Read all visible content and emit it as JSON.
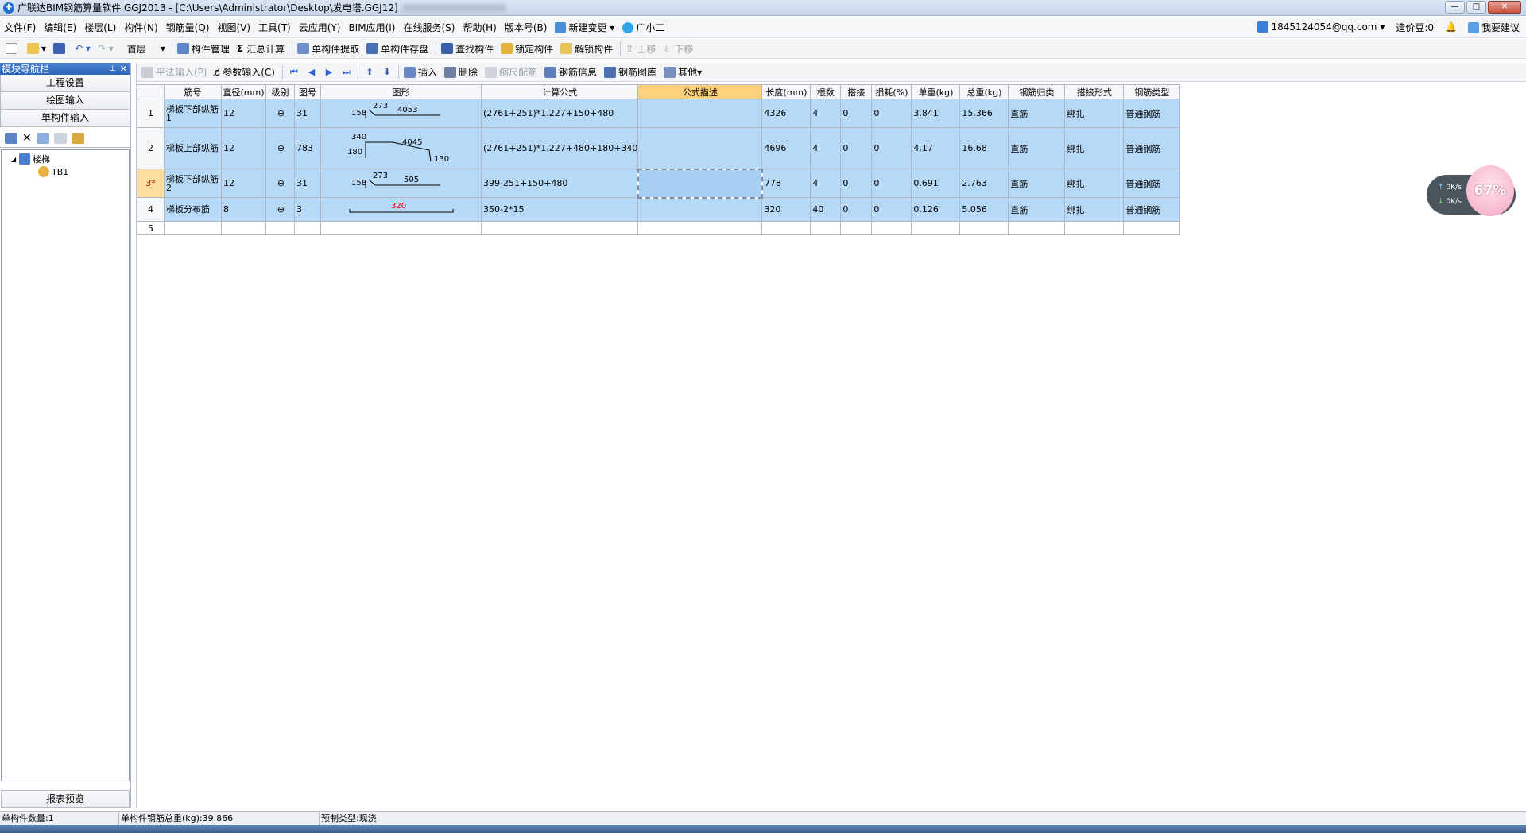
{
  "window": {
    "title": "广联达BIM钢筋算量软件 GGJ2013 - [C:\\Users\\Administrator\\Desktop\\发电塔.GGJ12]",
    "minimize": "—",
    "maximize": "□",
    "close": "✕"
  },
  "menu": {
    "items": [
      "文件(F)",
      "编辑(E)",
      "楼层(L)",
      "构件(N)",
      "钢筋量(Q)",
      "视图(V)",
      "工具(T)",
      "云应用(Y)",
      "BIM应用(I)",
      "在线服务(S)",
      "帮助(H)",
      "版本号(B)",
      "新建变更",
      "广小二"
    ],
    "account": "1845124054@qq.com",
    "price_beans": "造价豆:0",
    "suggest": "我要建议"
  },
  "toolbar1": {
    "floor": "首层",
    "component_manage": "构件管理",
    "sum_calc": "汇总计算",
    "single_extract": "单构件提取",
    "single_save": "单构件存盘",
    "find_component": "查找构件",
    "lock_component": "锁定构件",
    "unlock_component": "解锁构件",
    "move_up": "上移",
    "move_down": "下移"
  },
  "leftnav": {
    "header": "模块导航栏",
    "sections": [
      "工程设置",
      "绘图输入",
      "单构件输入"
    ],
    "tree_root": "楼梯",
    "tree_child": "TB1",
    "report": "报表预览"
  },
  "toolbar2": {
    "flat_input": "平法输入(P)",
    "param_input": "参数输入(C)",
    "insert": "插入",
    "delete": "删除",
    "scale_rebar": "缩尺配筋",
    "rebar_info": "钢筋信息",
    "rebar_library": "钢筋图库",
    "other": "其他"
  },
  "grid": {
    "headers": [
      "筋号",
      "直径(mm)",
      "级别",
      "图号",
      "图形",
      "计算公式",
      "公式描述",
      "长度(mm)",
      "根数",
      "搭接",
      "损耗(%)",
      "单重(kg)",
      "总重(kg)",
      "钢筋归类",
      "搭接形式",
      "钢筋类型"
    ],
    "rows": [
      {
        "num": "1",
        "name": "梯板下部纵筋1",
        "dia": "12",
        "level": "⊕",
        "fig": "31",
        "shape": {
          "left": "158",
          "top": "273",
          "main": "4053"
        },
        "formula": "(2761+251)*1.227+150+480",
        "desc": "",
        "length": "4326",
        "count": "4",
        "lap": "0",
        "loss": "0",
        "unit_w": "3.841",
        "total_w": "15.366",
        "category": "直筋",
        "lap_type": "绑扎",
        "type": "普通钢筋"
      },
      {
        "num": "2",
        "name": "梯板上部纵筋",
        "dia": "12",
        "level": "⊕",
        "fig": "783",
        "shape": {
          "a": "340",
          "b": "4045",
          "c": "180",
          "d": "130"
        },
        "formula": "(2761+251)*1.227+480+180+340",
        "desc": "",
        "length": "4696",
        "count": "4",
        "lap": "0",
        "loss": "0",
        "unit_w": "4.17",
        "total_w": "16.68",
        "category": "直筋",
        "lap_type": "绑扎",
        "type": "普通钢筋"
      },
      {
        "num": "3*",
        "name": "梯板下部纵筋2",
        "dia": "12",
        "level": "⊕",
        "fig": "31",
        "shape": {
          "left": "158",
          "top": "273",
          "main": "505"
        },
        "formula": "399-251+150+480",
        "desc": "",
        "length": "778",
        "count": "4",
        "lap": "0",
        "loss": "0",
        "unit_w": "0.691",
        "total_w": "2.763",
        "category": "直筋",
        "lap_type": "绑扎",
        "type": "普通钢筋"
      },
      {
        "num": "4",
        "name": "梯板分布筋",
        "dia": "8",
        "level": "⊕",
        "fig": "3",
        "shape": {
          "main": "320"
        },
        "formula": "350-2*15",
        "desc": "",
        "length": "320",
        "count": "40",
        "lap": "0",
        "loss": "0",
        "unit_w": "0.126",
        "total_w": "5.056",
        "category": "直筋",
        "lap_type": "绑扎",
        "type": "普通钢筋"
      }
    ],
    "empty_row_num": "5"
  },
  "status": {
    "count": "单构件数量:1",
    "total_weight": "单构件钢筋总重(kg):39.866",
    "prefab_type": "预制类型:现浇"
  },
  "speed": {
    "up": "0K/s",
    "down": "0K/s",
    "percent": "67%"
  },
  "colors": {
    "row_bg": "#b6d9f7",
    "selected_header": "#ffd17a",
    "accent": "#2e63b6",
    "shape_label_red": "#e00000"
  }
}
